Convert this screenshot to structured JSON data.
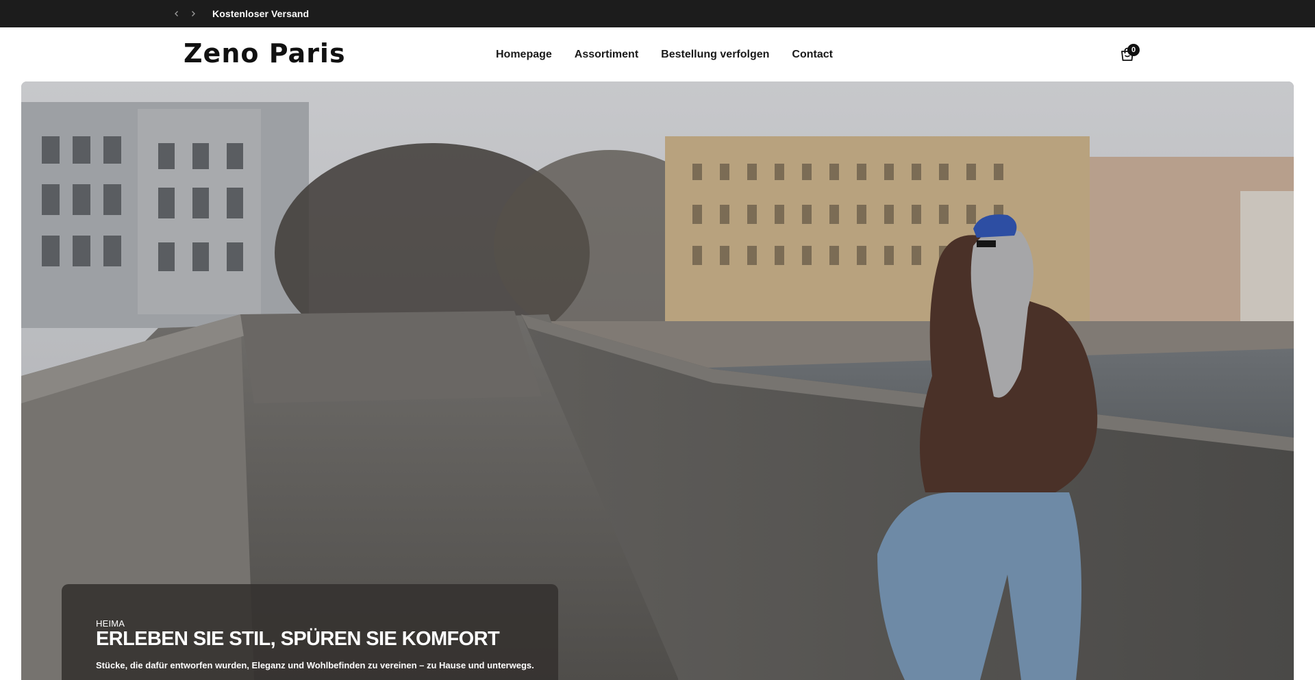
{
  "announcement": {
    "text": "Kostenloser Versand",
    "prev_icon": "chevron-left-icon",
    "next_icon": "chevron-right-icon"
  },
  "header": {
    "logo": "Zeno Paris",
    "nav": [
      {
        "label": "Homepage"
      },
      {
        "label": "Assortiment"
      },
      {
        "label": "Bestellung verfolgen"
      },
      {
        "label": "Contact"
      }
    ],
    "cart": {
      "icon": "shopping-bag-icon",
      "count": "0"
    }
  },
  "hero": {
    "eyebrow": "HEIMA",
    "title": "ERLEBEN SIE STIL, SPÜREN SIE KOMFORT",
    "subtitle": "Stücke, die dafür entworfen wurden, Eleganz und Wohlbefinden zu vereinen – zu Hause und unterwegs."
  },
  "colors": {
    "announcement_bg": "#1c1c1c",
    "header_bg": "#ffffff",
    "hero_card_bg": "#34312f",
    "text_dark": "#111111",
    "text_light": "#ffffff"
  }
}
